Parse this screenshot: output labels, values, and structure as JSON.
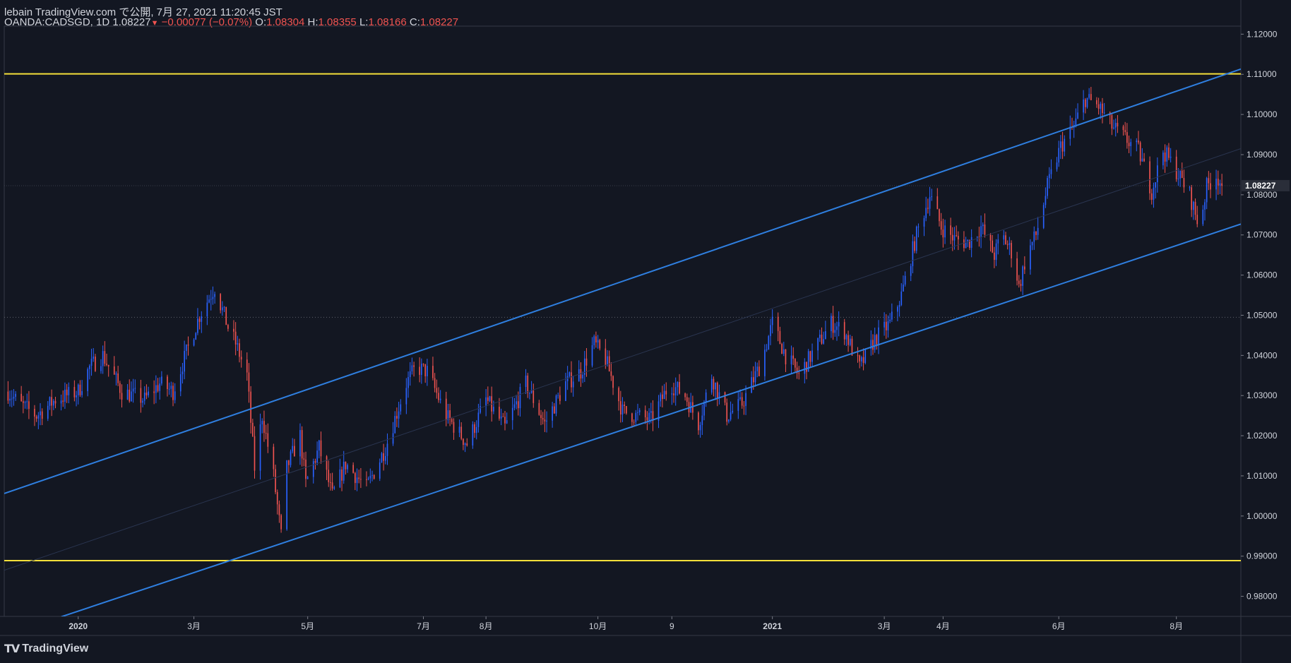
{
  "header": {
    "publish_line": "lebain TradingView.com で公開, 7月 27, 2021 11:20:45 JST",
    "symbol": "OANDA:CADSGD, 1D",
    "last": "1.08227",
    "change": "−0.00077 (−0.07%)",
    "o_label": "O:",
    "o_val": "1.08304",
    "h_label": "H:",
    "h_val": "1.08355",
    "l_label": "L:",
    "l_val": "1.08166",
    "c_label": "C:",
    "c_val": "1.08227"
  },
  "brand": {
    "logo_icon": "tradingview-logo-icon",
    "name": "TradingView"
  },
  "colors": {
    "bg": "#131722",
    "up": "#2962ff",
    "down": "#ef5350",
    "channel": "#2f7fe0",
    "level": "#f5e03a",
    "grid": "#363a45",
    "text": "#d1d4dc"
  },
  "chart_data": {
    "type": "candlestick",
    "symbol": "OANDA:CADSGD",
    "interval": "1D",
    "ylim": [
      0.975,
      1.122
    ],
    "y_ticks": [
      "1.12000",
      "1.11000",
      "1.10000",
      "1.09000",
      "1.08000",
      "1.07000",
      "1.06000",
      "1.05000",
      "1.04000",
      "1.03000",
      "1.02000",
      "1.01000",
      "1.00000",
      "0.99000",
      "0.98000"
    ],
    "y_tick_values": [
      1.12,
      1.11,
      1.1,
      1.09,
      1.08,
      1.07,
      1.06,
      1.05,
      1.04,
      1.03,
      1.02,
      1.01,
      1.0,
      0.99,
      0.98
    ],
    "x_ticks": [
      {
        "label": "2020",
        "date": "2020-01-01",
        "bold": true
      },
      {
        "label": "3月",
        "date": "2020-03-02"
      },
      {
        "label": "5月",
        "date": "2020-05-01"
      },
      {
        "label": "7月",
        "date": "2020-07-01"
      },
      {
        "label": "8月",
        "date": "2020-08-03"
      },
      {
        "label": "10月",
        "date": "2020-10-01"
      },
      {
        "label": "9",
        "date": "2020-11-09"
      },
      {
        "label": "2021",
        "date": "2021-01-01",
        "bold": true
      },
      {
        "label": "3月",
        "date": "2021-03-01"
      },
      {
        "label": "4月",
        "date": "2021-04-01"
      },
      {
        "label": "6月",
        "date": "2021-06-01"
      },
      {
        "label": "8月",
        "date": "2021-08-02"
      }
    ],
    "last_price_label": "1.08227",
    "last_price": 1.08227,
    "horizontal_levels": [
      1.1101,
      0.9889
    ],
    "dotted_level": 1.0495,
    "channel_lines": [
      {
        "name": "upper",
        "p1": {
          "date": "2019-11-23",
          "value": 1.0056
        },
        "p2": {
          "date": "2021-09-05",
          "value": 1.1113
        }
      },
      {
        "name": "lower",
        "p1": {
          "date": "2019-12-23",
          "value": 0.9749
        },
        "p2": {
          "date": "2021-09-05",
          "value": 1.0727
        }
      },
      {
        "name": "mid",
        "p1": {
          "date": "2019-11-23",
          "value": 0.9865
        },
        "p2": {
          "date": "2021-09-05",
          "value": 1.0915
        },
        "faint": true
      }
    ],
    "x_start_date": "2019-11-23",
    "x_end_date": "2021-09-05",
    "anchors": [
      {
        "date": "2019-11-25",
        "value": 1.031
      },
      {
        "date": "2019-12-01",
        "value": 1.028
      },
      {
        "date": "2019-12-10",
        "value": 1.025
      },
      {
        "date": "2019-12-20",
        "value": 1.029
      },
      {
        "date": "2020-01-01",
        "value": 1.031
      },
      {
        "date": "2020-01-07",
        "value": 1.037
      },
      {
        "date": "2020-01-14",
        "value": 1.04
      },
      {
        "date": "2020-01-24",
        "value": 1.031
      },
      {
        "date": "2020-02-05",
        "value": 1.029
      },
      {
        "date": "2020-02-13",
        "value": 1.033
      },
      {
        "date": "2020-02-20",
        "value": 1.031
      },
      {
        "date": "2020-02-28",
        "value": 1.042
      },
      {
        "date": "2020-03-05",
        "value": 1.05
      },
      {
        "date": "2020-03-13",
        "value": 1.057
      },
      {
        "date": "2020-03-20",
        "value": 1.047
      },
      {
        "date": "2020-03-24",
        "value": 1.043
      },
      {
        "date": "2020-03-30",
        "value": 1.035
      },
      {
        "date": "2020-04-03",
        "value": 1.012
      },
      {
        "date": "2020-04-07",
        "value": 1.025
      },
      {
        "date": "2020-04-13",
        "value": 1.01
      },
      {
        "date": "2020-04-17",
        "value": 0.995
      },
      {
        "date": "2020-04-20",
        "value": 1.012
      },
      {
        "date": "2020-04-27",
        "value": 1.02
      },
      {
        "date": "2020-04-30",
        "value": 1.008
      },
      {
        "date": "2020-05-07",
        "value": 1.017
      },
      {
        "date": "2020-05-14",
        "value": 1.005
      },
      {
        "date": "2020-05-21",
        "value": 1.013
      },
      {
        "date": "2020-06-01",
        "value": 1.007
      },
      {
        "date": "2020-06-11",
        "value": 1.017
      },
      {
        "date": "2020-06-22",
        "value": 1.033
      },
      {
        "date": "2020-06-27",
        "value": 1.037
      },
      {
        "date": "2020-07-03",
        "value": 1.036
      },
      {
        "date": "2020-07-13",
        "value": 1.025
      },
      {
        "date": "2020-07-24",
        "value": 1.018
      },
      {
        "date": "2020-08-03",
        "value": 1.029
      },
      {
        "date": "2020-08-13",
        "value": 1.022
      },
      {
        "date": "2020-08-24",
        "value": 1.033
      },
      {
        "date": "2020-09-03",
        "value": 1.023
      },
      {
        "date": "2020-09-14",
        "value": 1.033
      },
      {
        "date": "2020-09-22",
        "value": 1.036
      },
      {
        "date": "2020-09-29",
        "value": 1.043
      },
      {
        "date": "2020-10-05",
        "value": 1.039
      },
      {
        "date": "2020-10-14",
        "value": 1.026
      },
      {
        "date": "2020-10-21",
        "value": 1.025
      },
      {
        "date": "2020-10-29",
        "value": 1.024
      },
      {
        "date": "2020-11-08",
        "value": 1.033
      },
      {
        "date": "2020-11-16",
        "value": 1.03
      },
      {
        "date": "2020-11-23",
        "value": 1.023
      },
      {
        "date": "2020-11-30",
        "value": 1.035
      },
      {
        "date": "2020-12-08",
        "value": 1.025
      },
      {
        "date": "2020-12-16",
        "value": 1.028
      },
      {
        "date": "2020-12-26",
        "value": 1.038
      },
      {
        "date": "2021-01-01",
        "value": 1.048
      },
      {
        "date": "2021-01-08",
        "value": 1.04
      },
      {
        "date": "2021-01-15",
        "value": 1.035
      },
      {
        "date": "2021-01-24",
        "value": 1.042
      },
      {
        "date": "2021-02-01",
        "value": 1.048
      },
      {
        "date": "2021-02-08",
        "value": 1.046
      },
      {
        "date": "2021-02-16",
        "value": 1.037
      },
      {
        "date": "2021-02-24",
        "value": 1.044
      },
      {
        "date": "2021-03-04",
        "value": 1.048
      },
      {
        "date": "2021-03-10",
        "value": 1.055
      },
      {
        "date": "2021-03-18",
        "value": 1.07
      },
      {
        "date": "2021-03-25",
        "value": 1.08
      },
      {
        "date": "2021-03-31",
        "value": 1.072
      },
      {
        "date": "2021-04-07",
        "value": 1.069
      },
      {
        "date": "2021-04-14",
        "value": 1.068
      },
      {
        "date": "2021-04-21",
        "value": 1.072
      },
      {
        "date": "2021-04-28",
        "value": 1.065
      },
      {
        "date": "2021-05-02",
        "value": 1.07
      },
      {
        "date": "2021-05-08",
        "value": 1.065
      },
      {
        "date": "2021-05-11",
        "value": 1.057
      },
      {
        "date": "2021-05-15",
        "value": 1.065
      },
      {
        "date": "2021-05-20",
        "value": 1.07
      },
      {
        "date": "2021-05-26",
        "value": 1.082
      },
      {
        "date": "2021-06-02",
        "value": 1.092
      },
      {
        "date": "2021-06-09",
        "value": 1.097
      },
      {
        "date": "2021-06-15",
        "value": 1.104
      },
      {
        "date": "2021-06-22",
        "value": 1.102
      },
      {
        "date": "2021-06-29",
        "value": 1.097
      },
      {
        "date": "2021-07-06",
        "value": 1.094
      },
      {
        "date": "2021-07-13",
        "value": 1.091
      },
      {
        "date": "2021-07-20",
        "value": 1.081
      },
      {
        "date": "2021-07-26",
        "value": 1.091
      },
      {
        "date": "2021-08-02",
        "value": 1.086
      },
      {
        "date": "2021-08-09",
        "value": 1.08
      },
      {
        "date": "2021-08-14",
        "value": 1.072
      },
      {
        "date": "2021-08-18",
        "value": 1.082
      },
      {
        "date": "2021-08-23",
        "value": 1.085
      },
      {
        "date": "2021-08-26",
        "value": 1.0823
      }
    ]
  }
}
